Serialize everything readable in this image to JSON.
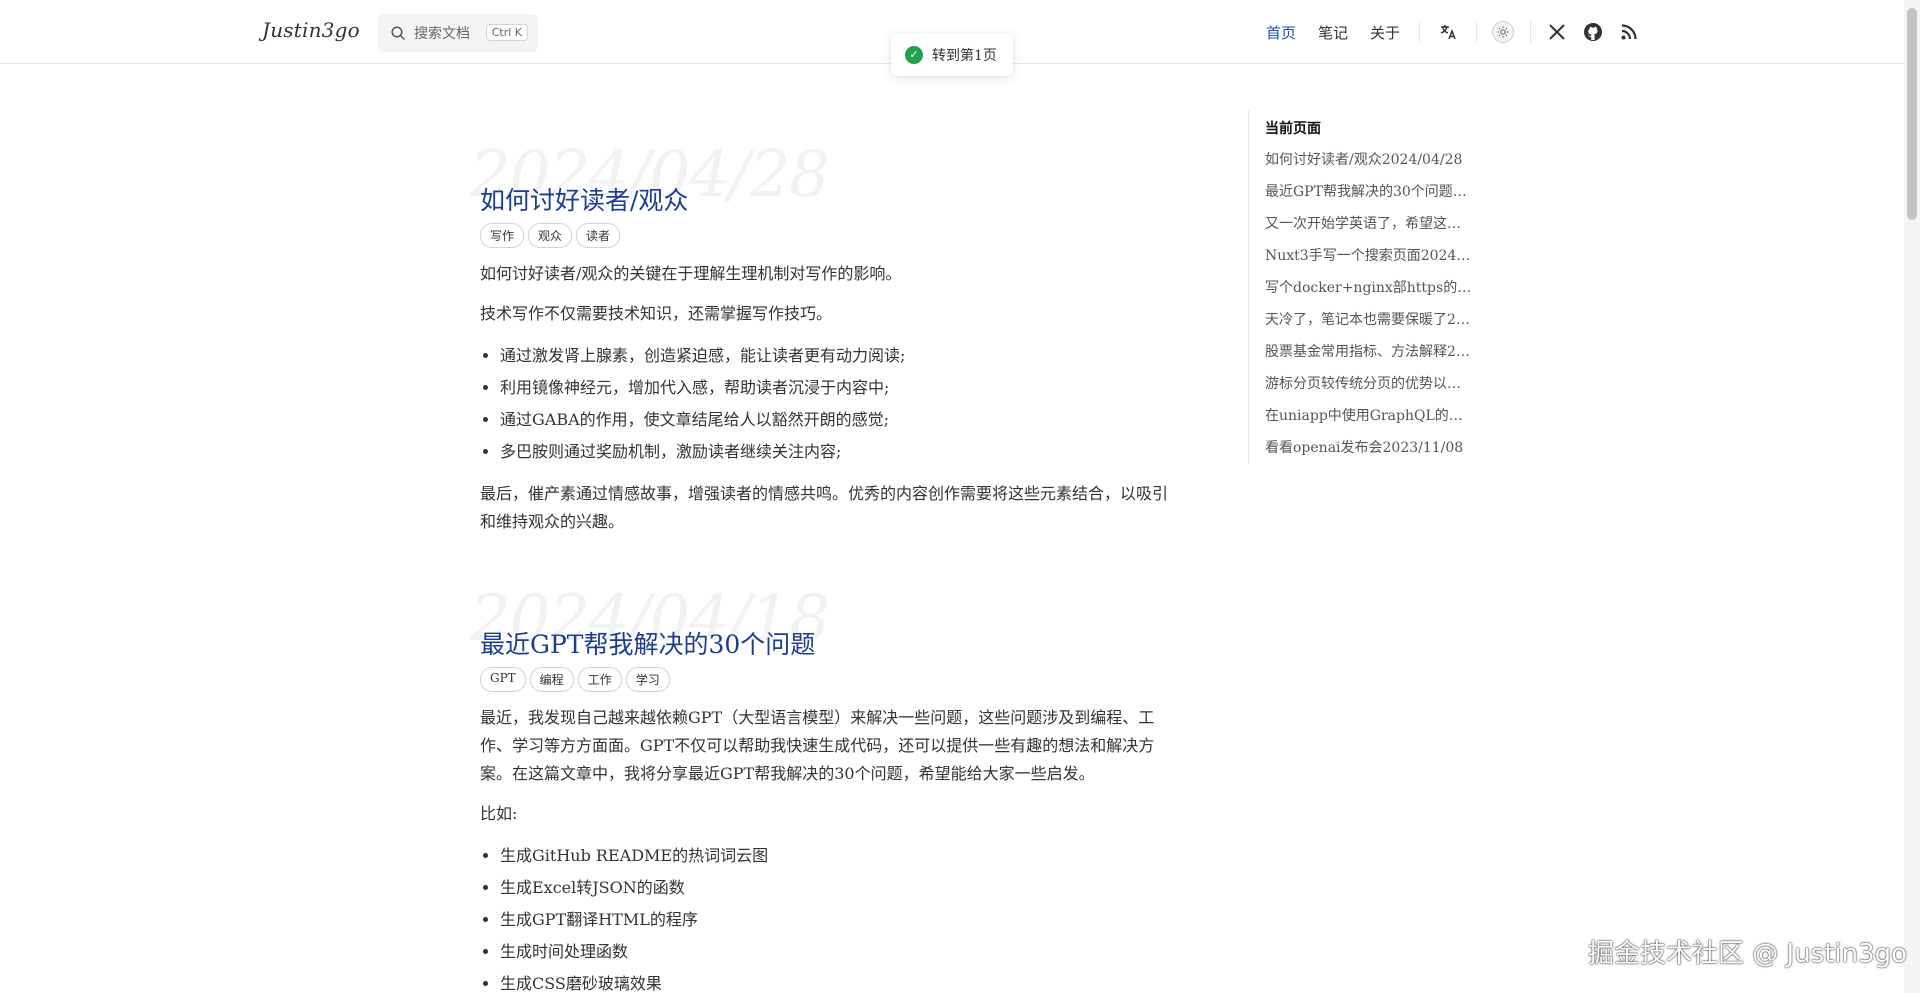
{
  "header": {
    "logo": "Justin3go",
    "search_placeholder": "搜索文档",
    "search_shortcut": "Ctrl K",
    "nav": [
      {
        "label": "首页",
        "active": true
      },
      {
        "label": "笔记",
        "active": false
      },
      {
        "label": "关于",
        "active": false
      }
    ],
    "icons": [
      "translate-icon",
      "theme-toggle-icon",
      "x-twitter-icon",
      "github-icon",
      "rss-icon"
    ]
  },
  "toast": {
    "text": "转到第1页",
    "icon": "check-circle-icon",
    "color": "#22a04e"
  },
  "articles": [
    {
      "bg_date": "2024/04/28",
      "title": "如何讨好读者/观众",
      "tags": [
        "写作",
        "观众",
        "读者"
      ],
      "paragraphs_before": [
        "如何讨好读者/观众的关键在于理解生理机制对写作的影响。",
        "技术写作不仅需要技术知识，还需掌握写作技巧。"
      ],
      "list": [
        "通过激发肾上腺素，创造紧迫感，能让读者更有动力阅读;",
        "利用镜像神经元，增加代入感，帮助读者沉浸于内容中;",
        "通过GABA的作用，使文章结尾给人以豁然开朗的感觉;",
        "多巴胺则通过奖励机制，激励读者继续关注内容;"
      ],
      "paragraph_after": "最后，催产素通过情感故事，增强读者的情感共鸣。优秀的内容创作需要将这些元素结合，以吸引和维持观众的兴趣。"
    },
    {
      "bg_date": "2024/04/18",
      "title": "最近GPT帮我解决的30个问题",
      "tags": [
        "GPT",
        "编程",
        "工作",
        "学习"
      ],
      "paragraphs_before": [
        "最近，我发现自己越来越依赖GPT（大型语言模型）来解决一些问题，这些问题涉及到编程、工作、学习等方方面面。GPT不仅可以帮助我快速生成代码，还可以提供一些有趣的想法和解决方案。在这篇文章中，我将分享最近GPT帮我解决的30个问题，希望能给大家一些启发。",
        "比如:"
      ],
      "list": [
        "生成GitHub README的热词词云图",
        "生成Excel转JSON的函数",
        "生成GPT翻译HTML的程序",
        "生成时间处理函数",
        "生成CSS磨砂玻璃效果"
      ]
    }
  ],
  "toc": {
    "heading": "当前页面",
    "items": [
      "如何讨好读者/观众2024/04/28",
      "最近GPT帮我解决的30个问题2…",
      "又一次开始学英语了，希望这…",
      "Nuxt3手写一个搜索页面2024/…",
      "写个docker+nginx部https的…",
      "天冷了，笔记本也需要保暖了2…",
      "股票基金常用指标、方法解释2…",
      "游标分页较传统分页的优势以…",
      "在uniapp中使用GraphQL的…",
      "看看openai发布会2023/11/08"
    ]
  },
  "watermark": "掘金技术社区 @ Justin3go",
  "colors": {
    "accent": "#1e3d8f",
    "nav_active": "#1e4fa8"
  }
}
